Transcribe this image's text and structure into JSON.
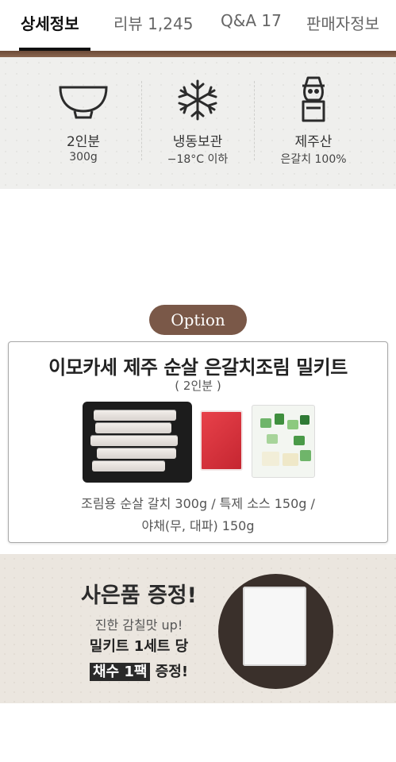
{
  "tabs": [
    {
      "label": "상세정보",
      "active": true
    },
    {
      "label": "리뷰 1,245",
      "active": false
    },
    {
      "label": "Q&A 17",
      "active": false
    },
    {
      "label": "판매자정보",
      "active": false
    }
  ],
  "info": [
    {
      "icon": "bowl-icon",
      "title": "2인분",
      "sub": "300g"
    },
    {
      "icon": "snowflake-icon",
      "title": "냉동보관",
      "sub": "−18°C 이하"
    },
    {
      "icon": "dolhareubang-icon",
      "title": "제주산",
      "sub": "은갈치 100%"
    }
  ],
  "option": {
    "label": "Option"
  },
  "product": {
    "title": "이모카세 제주 순살 은갈치조림 밀키트",
    "serving": "( 2인분 )",
    "desc_line1": "조림용 순살 갈치 300g / 특제 소스 150g /",
    "desc_line2": "야채(무, 대파) 150g"
  },
  "gift": {
    "heading": "사은품 증정!",
    "sub1": "진한 감칠맛 up!",
    "sub2": "밀키트 1세트 당",
    "highlight": "채수 1팩",
    "sub3_tail": " 증정!"
  },
  "colors": {
    "accent": "#7a5848",
    "info_bg": "#efefed",
    "gift_bg": "#ebe6df",
    "gift_circle": "#3a302b"
  }
}
